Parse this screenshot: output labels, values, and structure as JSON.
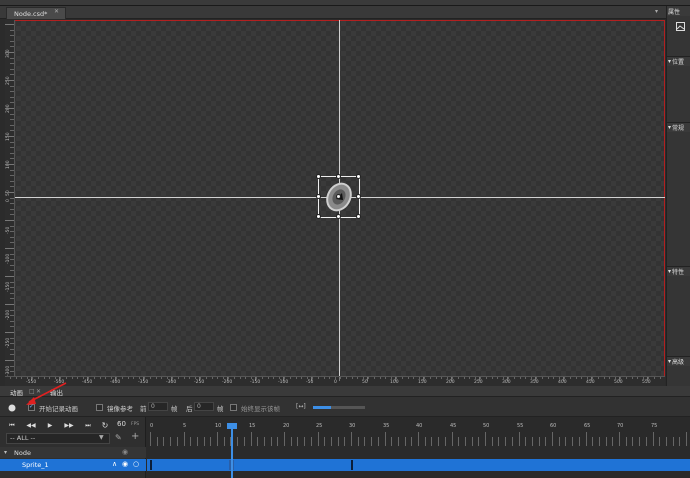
{
  "document_tab": {
    "label": "Node.csd*",
    "close": "✕"
  },
  "tab_bar_dropdown": "▾",
  "property_panel": {
    "title": "属性",
    "sections": [
      {
        "label": "位置"
      },
      {
        "label": "常规"
      },
      {
        "label": "特性"
      },
      {
        "label": "高级"
      }
    ]
  },
  "ruler_left_labels": [
    "300",
    "250",
    "200",
    "150",
    "100",
    "50",
    "0",
    "-50",
    "-100",
    "-150",
    "-200",
    "-250",
    "-300"
  ],
  "ruler_bottom_labels": [
    "-550",
    "-500",
    "-450",
    "-400",
    "-350",
    "-300",
    "-250",
    "-200",
    "-150",
    "-100",
    "-50",
    "0",
    "50",
    "100",
    "150",
    "200",
    "250",
    "300",
    "350",
    "400",
    "450",
    "500",
    "550"
  ],
  "animation_panel": {
    "tabs": [
      {
        "label": "动画"
      },
      {
        "label": "输出"
      }
    ],
    "record_checkbox": {
      "label": "开始记录动画",
      "checked": true
    },
    "onion_checkbox": {
      "label": "镜像参考",
      "checked": false
    },
    "before_label": "前",
    "before_value": "0",
    "frame_label_1": "帧",
    "after_label": "后",
    "after_value": "0",
    "frame_label_2": "帧",
    "always_show_checkbox": {
      "label": "始终显示该帧",
      "checked": false
    },
    "bracket_button": "[↔]",
    "zoom_level": 0.35,
    "fps_value": "60",
    "fps_label": "FPS",
    "filter_select": "-- ALL --",
    "tree": [
      {
        "label": "Node"
      },
      {
        "label": "Sprite_1"
      }
    ],
    "timeline_numbers": [
      "0",
      "5",
      "10",
      "12",
      "15",
      "20",
      "25",
      "30",
      "35",
      "40",
      "45",
      "50",
      "55",
      "60",
      "65",
      "70",
      "75"
    ],
    "playhead_frame": 12,
    "keyframes": [
      0,
      12,
      30
    ]
  },
  "colors": {
    "accent": "#1f73d6",
    "selection_border": "#b32020"
  }
}
